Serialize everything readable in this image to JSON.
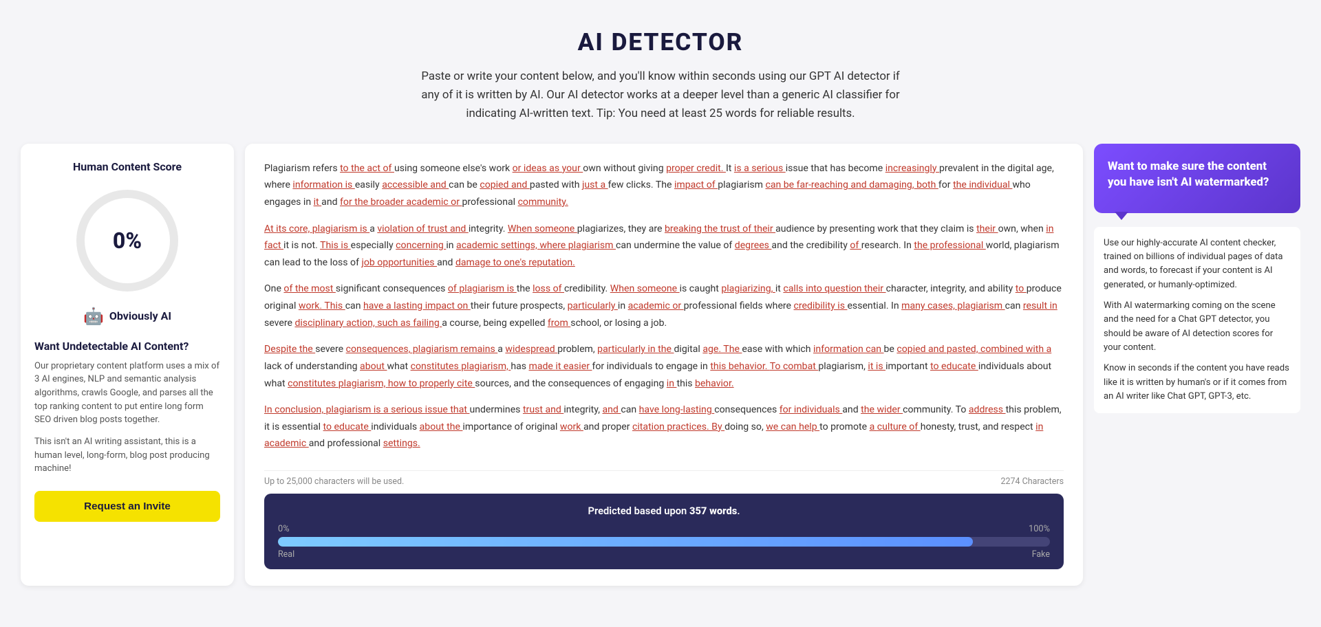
{
  "header": {
    "title": "AI DETECTOR",
    "description": "Paste or write your content below, and you'll know within seconds using our GPT AI detector if any of it is written by AI. Our AI detector works at a deeper level than a generic AI classifier for indicating AI-written text. Tip: You need at least 25 words for reliable results."
  },
  "left_panel": {
    "title": "Human Content Score",
    "score": "0%",
    "score_label": "Obviously AI",
    "ai_icon": "🤖",
    "cta_title": "Want Undetectable AI Content?",
    "cta_desc1": "Our proprietary content platform uses a mix of 3 AI engines, NLP and semantic analysis algorithms, crawls Google, and parses all the top ranking content to put entire long form SEO driven blog posts together.",
    "cta_desc2": "This isn't an AI writing assistant, this is a human level, long-form, blog post producing machine!",
    "invite_btn": "Request an Invite"
  },
  "center_panel": {
    "content": [
      "Plagiarism refers to the act of using someone else's work or ideas as your own without giving proper credit. It is a serious issue that has become increasingly prevalent in the digital age, where information is easily accessible and can be copied and pasted with just a few clicks. The impact of plagiarism can be far-reaching and damaging, both for the individual who engages in it and for the broader academic or professional community.",
      "At its core, plagiarism is a violation of trust and integrity. When someone plagiarizes, they are breaking the trust of their audience by presenting work that they claim is their own, when in fact it is not. This is especially concerning in academic settings, where plagiarism can undermine the value of degrees and the credibility of research. In the professional world, plagiarism can lead to the loss of job opportunities and damage to one's reputation.",
      "One of the most significant consequences of plagiarism is the loss of credibility. When someone is caught plagiarizing, it calls into question their character, integrity, and ability to produce original work. This can have a lasting impact on their future prospects, particularly in academic or professional fields where credibility is essential. In many cases, plagiarism can result in severe disciplinary action, such as failing a course, being expelled from school, or losing a job.",
      "Despite the severe consequences, plagiarism remains a widespread problem, particularly in the digital age. The ease with which information can be copied and pasted, combined with a lack of understanding about what constitutes plagiarism, has made it easier for individuals to engage in this behavior. To combat plagiarism, it is important to educate individuals about what constitutes plagiarism, how to properly cite sources, and the consequences of engaging in this behavior.",
      "In conclusion, plagiarism is a serious issue that undermines trust and integrity, and can have long-lasting consequences for individuals and the wider community. To address this problem, it is essential to educate individuals about the importance of original work and proper citation practices. By doing so, we can help to promote a culture of honesty, trust, and respect in academic and professional settings."
    ],
    "footer_left": "Up to 25,000 characters will be used.",
    "footer_right": "2274 Characters",
    "prediction": {
      "label": "Predicted based upon",
      "words": "357 words",
      "percent_real": "0%",
      "label_real": "Real",
      "percent_fake": "100%",
      "label_fake": "Fake"
    }
  },
  "right_panel": {
    "watermark_title": "Want to make sure the content you have isn't AI watermarked?",
    "desc1": "Use our highly-accurate AI content checker, trained on billions of individual pages of data and words, to forecast if your content is AI generated, or humanly-optimized.",
    "desc2": "With AI watermarking coming on the scene and the need for a Chat GPT detector, you should be aware of AI detection scores for your content.",
    "desc3": "Know in seconds if the content you have reads like it is written by human's or if it comes from an AI writer like Chat GPT, GPT-3, etc."
  }
}
